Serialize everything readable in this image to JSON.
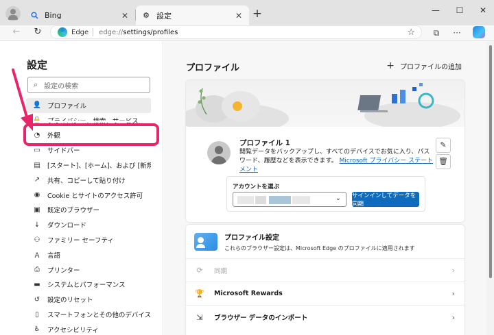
{
  "browser": {
    "tabs": [
      {
        "label": "Bing",
        "icon": "search-icon"
      },
      {
        "label": "設定",
        "icon": "gear-icon"
      }
    ],
    "address": {
      "site_label": "Edge",
      "url_host": "edge://",
      "url_path": "settings/profiles"
    }
  },
  "sidebar": {
    "title": "設定",
    "search_placeholder": "設定の検索",
    "items": [
      {
        "label": "プロファイル",
        "icon": "profile-icon"
      },
      {
        "label": "プライバシー、検索、サービス",
        "icon": "lock-icon"
      },
      {
        "label": "外観",
        "icon": "palette-icon"
      },
      {
        "label": "サイドバー",
        "icon": "sidebar-icon"
      },
      {
        "label": "[スタート]、[ホーム]、および [新規] タブ",
        "icon": "home-icon"
      },
      {
        "label": "共有、コピーして貼り付け",
        "icon": "share-icon"
      },
      {
        "label": "Cookie とサイトのアクセス許可",
        "icon": "cookie-icon"
      },
      {
        "label": "既定のブラウザー",
        "icon": "browser-icon"
      },
      {
        "label": "ダウンロード",
        "icon": "download-icon"
      },
      {
        "label": "ファミリー セーフティ",
        "icon": "family-icon"
      },
      {
        "label": "言語",
        "icon": "language-icon"
      },
      {
        "label": "プリンター",
        "icon": "printer-icon"
      },
      {
        "label": "システムとパフォーマンス",
        "icon": "system-icon"
      },
      {
        "label": "設定のリセット",
        "icon": "reset-icon"
      },
      {
        "label": "スマートフォンとその他のデバイス",
        "icon": "phone-icon"
      },
      {
        "label": "アクセシビリティ",
        "icon": "accessibility-icon"
      }
    ]
  },
  "main": {
    "title": "プロファイル",
    "add_profile": "プロファイルの追加",
    "profile": {
      "name": "プロファイル 1",
      "description": "閲覧データをバックアップし、すべてのデバイスでお気に入り、パスワード、履歴などを表示できます。",
      "privacy_link": "Microsoft プライバシー ステートメント",
      "account_label": "アカウントを選ぶ",
      "signin_button": "サインインしてデータを同期"
    },
    "settings_header": {
      "title": "プロファイル設定",
      "subtitle": "これらのブラウザー設定は、Microsoft Edge のプロファイルに適用されます"
    },
    "rows": [
      {
        "label": "同期",
        "icon": "sync-icon",
        "enabled": false
      },
      {
        "label": "Microsoft Rewards",
        "icon": "rewards-icon",
        "enabled": true
      },
      {
        "label": "ブラウザー データのインポート",
        "icon": "import-icon",
        "enabled": true
      }
    ]
  },
  "colors": {
    "highlight": "#e8256b",
    "accent": "#0f6cbd"
  }
}
